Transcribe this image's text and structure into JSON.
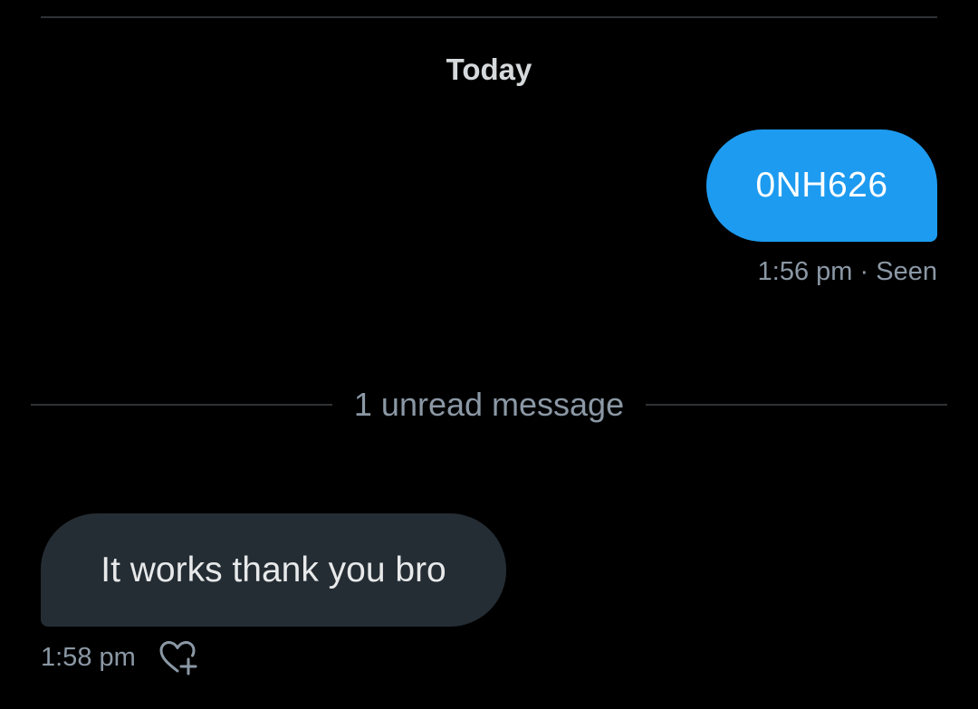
{
  "conversation": {
    "day_label": "Today",
    "unread_label": "1 unread message",
    "messages": [
      {
        "direction": "sent",
        "text": "0NH626",
        "time": "1:56 pm",
        "separator": "·",
        "status": "Seen"
      },
      {
        "direction": "received",
        "text": "It works thank you bro",
        "time": "1:58 pm",
        "reaction_icon": "heart-plus-icon"
      }
    ]
  },
  "colors": {
    "background": "#000000",
    "sent_bubble": "#1d9bf0",
    "received_bubble": "#252d34",
    "muted_text": "#8b98a5",
    "divider": "#2f3336"
  }
}
